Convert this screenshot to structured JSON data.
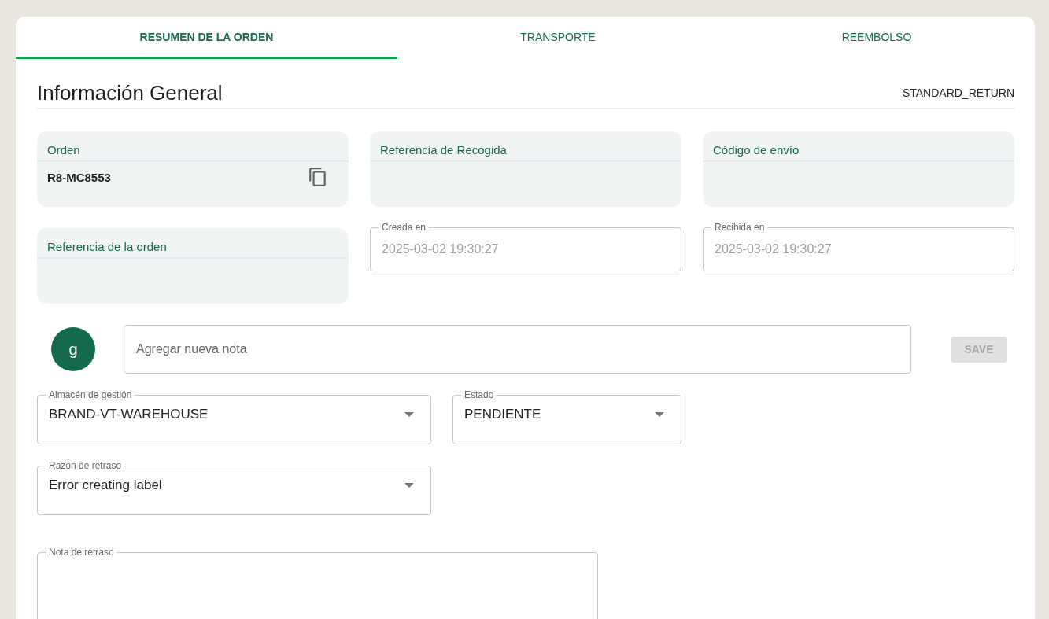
{
  "tabs": [
    {
      "label": "RESUMEN DE LA ORDEN",
      "selected": true
    },
    {
      "label": "TRANSPORTE",
      "selected": false
    },
    {
      "label": "REEMBOLSO",
      "selected": false
    }
  ],
  "section": {
    "title": "Información General",
    "return_type": "STANDARD_RETURN"
  },
  "fields": [
    {
      "kind": "card",
      "label": "Orden",
      "value": "R8-MC8553",
      "copyable": true
    },
    {
      "kind": "card",
      "label": "Referencia de Recogida",
      "copyable": false
    },
    {
      "kind": "card",
      "label": "Código de envío",
      "copyable": false
    },
    {
      "kind": "card",
      "label": "Referencia de la orden",
      "copyable": false
    },
    {
      "kind": "date",
      "label": "Creada en",
      "value": "2025-03-02 19:30:27",
      "disabled": true
    },
    {
      "kind": "date",
      "label": "Recibida en",
      "value": "2025-03-02 19:30:27",
      "disabled": true
    }
  ],
  "note": {
    "avatar": "g",
    "placeholder": "Agregar nueva nota",
    "save": {
      "label": "SAVE",
      "disabled": true
    }
  },
  "selects": [
    [
      {
        "label": "Almacén de gestión",
        "value": "BRAND-VT-WAREHOUSE"
      },
      {
        "label": "Estado",
        "value": "PENDIENTE"
      }
    ],
    [
      {
        "label": "Razón de retraso",
        "value": "Error creating label"
      }
    ]
  ],
  "delay_note": {
    "label": "Nota de retraso"
  }
}
